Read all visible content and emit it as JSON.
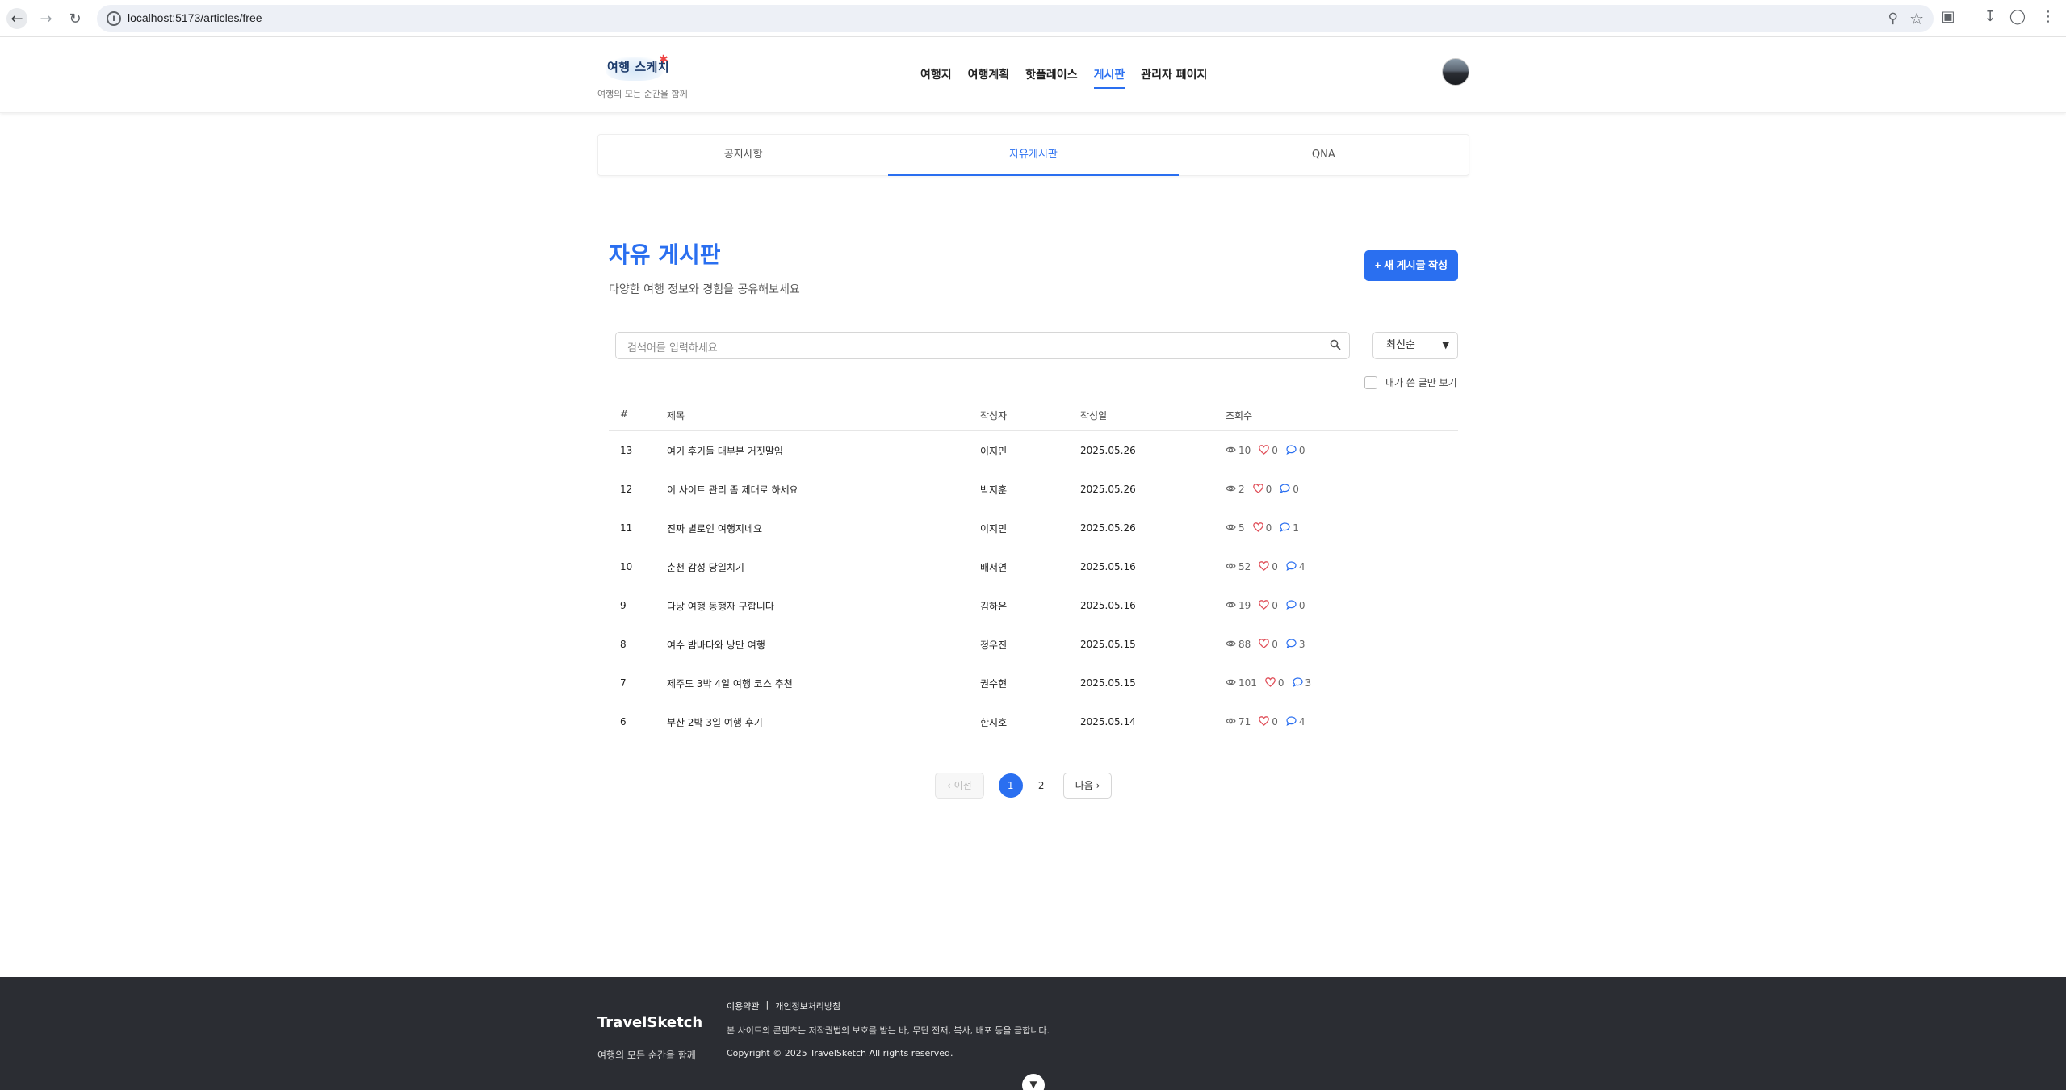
{
  "browser": {
    "url": "localhost:5173/articles/free"
  },
  "header": {
    "logo_text": "여행 스케치",
    "tagline": "여행의 모든 순간을 함께",
    "nav": [
      {
        "label": "여행지",
        "active": false
      },
      {
        "label": "여행계획",
        "active": false
      },
      {
        "label": "핫플레이스",
        "active": false
      },
      {
        "label": "게시판",
        "active": true
      },
      {
        "label": "관리자 페이지",
        "active": false
      }
    ]
  },
  "subtabs": [
    {
      "label": "공지사항",
      "active": false
    },
    {
      "label": "자유게시판",
      "active": true
    },
    {
      "label": "QNA",
      "active": false
    }
  ],
  "page": {
    "title": "자유 게시판",
    "subtitle": "다양한 여행 정보와 경험을 공유해보세요",
    "new_post_label": "+ 새 게시글 작성"
  },
  "search": {
    "placeholder": "검색어를 입력하세요",
    "sort_value": "최신순",
    "mine_only_label": "내가 쓴 글만 보기"
  },
  "table": {
    "headers": {
      "num": "#",
      "title": "제목",
      "author": "작성자",
      "date": "작성일",
      "views": "조회수"
    },
    "rows": [
      {
        "num": "13",
        "title": "여기 후기들 대부분 거짓말임",
        "author": "이지민",
        "date": "2025.05.26",
        "views": "10",
        "likes": "0",
        "comments": "0"
      },
      {
        "num": "12",
        "title": "이 사이트 관리 좀 제대로 하세요",
        "author": "박지훈",
        "date": "2025.05.26",
        "views": "2",
        "likes": "0",
        "comments": "0"
      },
      {
        "num": "11",
        "title": "진짜 별로인 여행지네요",
        "author": "이지민",
        "date": "2025.05.26",
        "views": "5",
        "likes": "0",
        "comments": "1"
      },
      {
        "num": "10",
        "title": "춘천 감성 당일치기",
        "author": "배서연",
        "date": "2025.05.16",
        "views": "52",
        "likes": "0",
        "comments": "4"
      },
      {
        "num": "9",
        "title": "다낭 여행 동행자 구합니다",
        "author": "김하은",
        "date": "2025.05.16",
        "views": "19",
        "likes": "0",
        "comments": "0"
      },
      {
        "num": "8",
        "title": "여수 밤바다와 낭만 여행",
        "author": "정우진",
        "date": "2025.05.15",
        "views": "88",
        "likes": "0",
        "comments": "3"
      },
      {
        "num": "7",
        "title": "제주도 3박 4일 여행 코스 추천",
        "author": "권수현",
        "date": "2025.05.15",
        "views": "101",
        "likes": "0",
        "comments": "3"
      },
      {
        "num": "6",
        "title": "부산 2박 3일 여행 후기",
        "author": "한지호",
        "date": "2025.05.14",
        "views": "71",
        "likes": "0",
        "comments": "4"
      }
    ]
  },
  "pagination": {
    "prev_label": "이전",
    "next_label": "다음",
    "pages": [
      "1",
      "2"
    ],
    "current": "1"
  },
  "footer": {
    "brand": "TravelSketch",
    "tagline": "여행의 모든 순간을 함께",
    "links": [
      "이용약관",
      "개인정보처리방침"
    ],
    "separator": "|",
    "notice": "본 사이트의 콘텐츠는 저작권법의 보호를 받는 바, 무단 전재, 복사, 배포 등을 금합니다.",
    "copyright": "Copyright © 2025 TravelSketch All rights reserved."
  },
  "colors": {
    "accent": "#2a6ff0",
    "footer_bg": "#2b2d33",
    "like_icon": "#e0505a",
    "comment_icon": "#2a6ff0"
  },
  "icons": [
    "back-icon",
    "forward-icon",
    "reload-icon",
    "info-icon",
    "zoom-icon",
    "star-icon",
    "extensions-icon",
    "download-icon",
    "profile-icon",
    "menu-icon",
    "search-icon",
    "eye-icon",
    "heart-icon",
    "comment-icon",
    "chevron-left-icon",
    "chevron-right-icon",
    "chevron-down-icon"
  ]
}
